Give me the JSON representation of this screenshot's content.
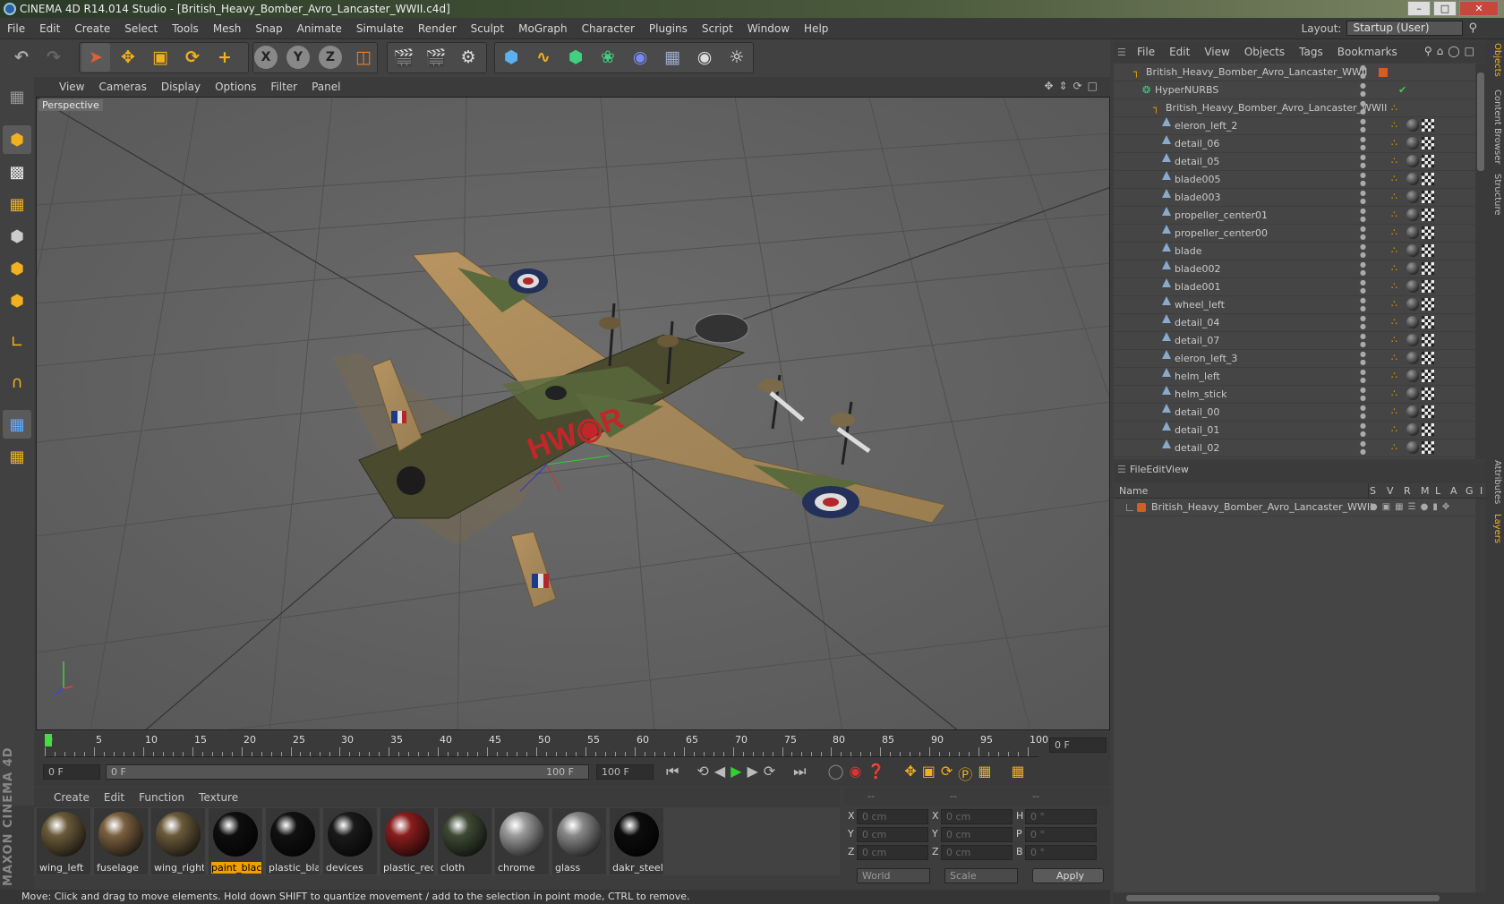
{
  "window": {
    "title": "CINEMA 4D R14.014 Studio - [British_Heavy_Bomber_Avro_Lancaster_WWII.c4d]",
    "min": "–",
    "max": "□",
    "close": "✕"
  },
  "menubar": {
    "items": [
      "File",
      "Edit",
      "Create",
      "Select",
      "Tools",
      "Mesh",
      "Snap",
      "Animate",
      "Simulate",
      "Render",
      "Sculpt",
      "MoGraph",
      "Character",
      "Plugins",
      "Script",
      "Window",
      "Help"
    ],
    "layout_label": "Layout:",
    "layout_value": "Startup (User)"
  },
  "toolbar": {
    "icons": [
      "undo-icon",
      "redo-icon",
      "select-icon",
      "move-icon",
      "scale-icon",
      "rotate-icon",
      "add-icon",
      "x-axis-icon",
      "y-axis-icon",
      "z-axis-icon",
      "coordinate-system-icon",
      "render-view-icon",
      "render-picture-viewer-icon",
      "render-settings-icon",
      "cube-primitive-icon",
      "spline-icon",
      "nurbs-icon",
      "array-icon",
      "deformer-icon",
      "floor-icon",
      "camera-icon",
      "light-icon"
    ],
    "x": "X",
    "y": "Y",
    "z": "Z"
  },
  "viewport": {
    "menu": [
      "View",
      "Cameras",
      "Display",
      "Options",
      "Filter",
      "Panel"
    ],
    "label": "Perspective",
    "nose_art": "HW◉R"
  },
  "timeline": {
    "ticks": [
      "0",
      "5",
      "10",
      "15",
      "20",
      "25",
      "30",
      "35",
      "40",
      "45",
      "50",
      "55",
      "60",
      "65",
      "70",
      "75",
      "80",
      "85",
      "90",
      "95",
      "100"
    ],
    "current_frame": "0 F",
    "start_field": "0 F",
    "range_start": "0 F",
    "range_end": "100 F",
    "end_field": "100 F"
  },
  "materials": {
    "menu": [
      "Create",
      "Edit",
      "Function",
      "Texture"
    ],
    "items": [
      {
        "name": "wing_left",
        "color": "#6a5a3a",
        "selected": false
      },
      {
        "name": "fuselage",
        "color": "#7a6040",
        "selected": false
      },
      {
        "name": "wing_right",
        "color": "#6a5a3a",
        "selected": false
      },
      {
        "name": "paint_black",
        "color": "#0e0e0e",
        "selected": true
      },
      {
        "name": "plastic_black",
        "color": "#111111",
        "selected": false
      },
      {
        "name": "devices",
        "color": "#1a1a1a",
        "selected": false
      },
      {
        "name": "plastic_red",
        "color": "#8a1d1d",
        "selected": false
      },
      {
        "name": "cloth",
        "color": "#3d4a35",
        "selected": false
      },
      {
        "name": "chrome",
        "color": "#9a9a9a",
        "selected": false
      },
      {
        "name": "glass",
        "color": "#888888",
        "selected": false
      },
      {
        "name": "dakr_steel",
        "color": "#0c0c0c",
        "selected": false
      }
    ]
  },
  "coords": {
    "header": [
      "--",
      "--",
      "--"
    ],
    "rows": [
      {
        "a": "X",
        "av": "0 cm",
        "b": "X",
        "bv": "0 cm",
        "c": "H",
        "cv": "0 °"
      },
      {
        "a": "Y",
        "av": "0 cm",
        "b": "Y",
        "bv": "0 cm",
        "c": "P",
        "cv": "0 °"
      },
      {
        "a": "Z",
        "av": "0 cm",
        "b": "Z",
        "bv": "0 cm",
        "c": "B",
        "cv": "0 °"
      }
    ],
    "mode1": "World",
    "mode2": "Scale",
    "apply": "Apply"
  },
  "status": "Move: Click and drag to move elements. Hold down SHIFT to quantize movement / add to the selection in point mode, CTRL to remove.",
  "maxon_logo": "MAXON CINEMA 4D",
  "objects": {
    "menu": [
      "File",
      "Edit",
      "View",
      "Objects",
      "Tags",
      "Bookmarks"
    ],
    "root": "British_Heavy_Bomber_Avro_Lancaster_WWII",
    "hypernurbs": "HyperNURBS",
    "group": "British_Heavy_Bomber_Avro_Lancaster_WWII",
    "items": [
      "eleron_left_2",
      "detail_06",
      "detail_05",
      "blade005",
      "blade003",
      "propeller_center01",
      "propeller_center00",
      "blade",
      "blade002",
      "blade001",
      "wheel_left",
      "detail_04",
      "detail_07",
      "eleron_left_3",
      "helm_left",
      "helm_stick",
      "detail_00",
      "detail_01",
      "detail_02"
    ]
  },
  "layers": {
    "menu": [
      "File",
      "Edit",
      "View"
    ],
    "columns": [
      "Name",
      "S",
      "V",
      "R",
      "M",
      "L",
      "A",
      "G",
      "I"
    ],
    "rows": [
      "British_Heavy_Bomber_Avro_Lancaster_WWII"
    ]
  },
  "sidetabs": [
    "Objects",
    "Content Browser",
    "Structure",
    "Attributes",
    "Layers"
  ]
}
